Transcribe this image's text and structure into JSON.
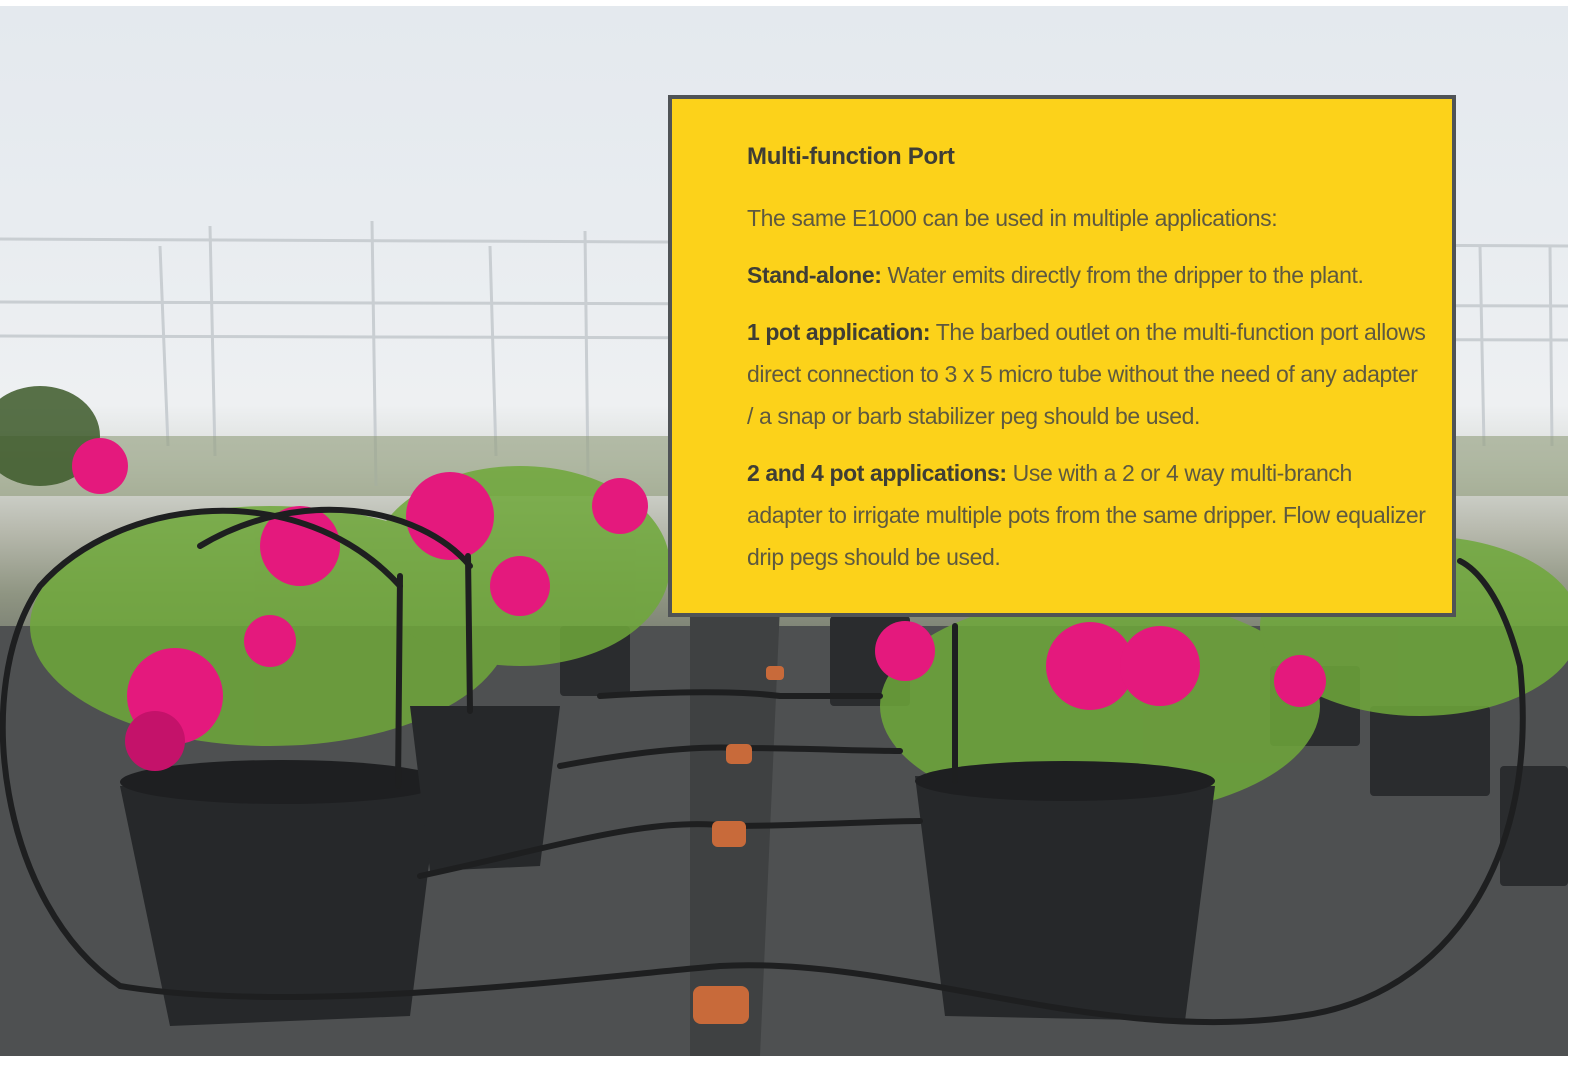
{
  "photo": {
    "subject": "greenhouse-potted-pink-flowers-drip-irrigation",
    "colors": {
      "sky": "#e4e9ee",
      "flower": "#e4197d",
      "pot": "#2a2c2e",
      "leaf": "#6fa83a",
      "ground": "#4b4d4d",
      "tube": "#1e1f20",
      "dripper": "#c86a3a"
    }
  },
  "info_box": {
    "background": "#fcd21a",
    "border": "#4f5356",
    "title": "Multi-function Port",
    "intro": "The same E1000 can be used in multiple applications:",
    "items": [
      {
        "label": "Stand-alone:",
        "text": " Water emits directly from the dripper to the plant."
      },
      {
        "label": "1 pot application:",
        "text": " The barbed outlet on the multi-function port allows direct connection to 3 x 5 micro tube without the need of any adapter / a snap or barb stabilizer peg should be used."
      },
      {
        "label": "2 and 4 pot applications:",
        "text": " Use with a 2 or 4 way multi-branch adapter to irrigate multiple pots from the same dripper. Flow equalizer drip pegs should be used."
      }
    ]
  }
}
